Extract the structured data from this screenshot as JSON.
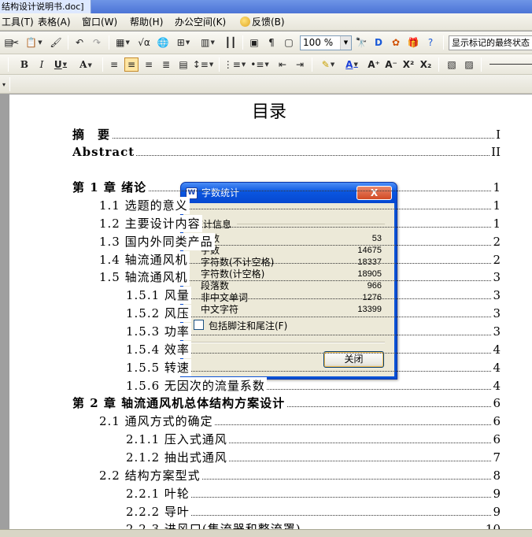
{
  "window": {
    "title": "结构设计说明书.doc]"
  },
  "menubar": {
    "items": [
      "工具(T)",
      "表格(A)",
      "窗口(W)",
      "帮助(H)",
      "办公空间(K)",
      "反馈(B)"
    ]
  },
  "toolbar1": {
    "zoom": "100 %",
    "status_text": "显示标记的最终状态"
  },
  "document": {
    "toc_heading": "目录",
    "watermark_url": "www.docin.com",
    "toc": [
      {
        "text": "摘　要",
        "page": "I",
        "level": 0,
        "bold": true
      },
      {
        "text": "Abstract",
        "page": "II",
        "level": 0,
        "bold": true
      },
      {
        "text": "第 1 章  绪论",
        "page": "1",
        "level": 0,
        "bold": true
      },
      {
        "text": "1.1 选题的意义",
        "page": "1",
        "level": 1,
        "bold": false
      },
      {
        "text": "1.2 主要设计内容",
        "page": "1",
        "level": 1,
        "bold": false
      },
      {
        "text": "1.3 国内外同类产品",
        "page": "2",
        "level": 1,
        "bold": false
      },
      {
        "text": "1.4 轴流通风机",
        "page": "2",
        "level": 1,
        "bold": false
      },
      {
        "text": "1.5 轴流通风机",
        "page": "3",
        "level": 1,
        "bold": false
      },
      {
        "text": "1.5.1 风量",
        "page": "3",
        "level": 2,
        "bold": false
      },
      {
        "text": "1.5.2 风压",
        "page": "3",
        "level": 2,
        "bold": false
      },
      {
        "text": "1.5.3 功率",
        "page": "3",
        "level": 2,
        "bold": false
      },
      {
        "text": "1.5.4 效率",
        "page": "4",
        "level": 2,
        "bold": false
      },
      {
        "text": "1.5.5 转速",
        "page": "4",
        "level": 2,
        "bold": false
      },
      {
        "text": "1.5.6 无因次的流量系数",
        "page": "4",
        "level": 2,
        "bold": false
      },
      {
        "text": "第 2 章  轴流通风机总体结构方案设计",
        "page": "6",
        "level": 0,
        "bold": true
      },
      {
        "text": "2.1 通风方式的确定",
        "page": "6",
        "level": 1,
        "bold": false
      },
      {
        "text": "2.1.1 压入式通风",
        "page": "6",
        "level": 2,
        "bold": false
      },
      {
        "text": "2.1.2 抽出式通风",
        "page": "7",
        "level": 2,
        "bold": false
      },
      {
        "text": "2.2 结构方案型式",
        "page": "8",
        "level": 1,
        "bold": false
      },
      {
        "text": "2.2.1 叶轮",
        "page": "9",
        "level": 2,
        "bold": false
      },
      {
        "text": "2.2.2 导叶",
        "page": "9",
        "level": 2,
        "bold": false
      },
      {
        "text": "2.2.3 进风口(集流器和整流罩)",
        "page": "10",
        "level": 2,
        "bold": false
      }
    ]
  },
  "dialog": {
    "title": "字数统计",
    "close_glyph": "X",
    "group_label": "统计信息",
    "stats": [
      {
        "label": "页数",
        "value": "53"
      },
      {
        "label": "字数",
        "value": "14675"
      },
      {
        "label": "字符数(不计空格)",
        "value": "18337"
      },
      {
        "label": "字符数(计空格)",
        "value": "18905"
      },
      {
        "label": "段落数",
        "value": "966"
      },
      {
        "label": "非中文单词",
        "value": "1276"
      },
      {
        "label": "中文字符",
        "value": "13399"
      }
    ],
    "checkbox_label": "包括脚注和尾注(F)",
    "checkbox_checked": false,
    "button_label": "关闭"
  }
}
